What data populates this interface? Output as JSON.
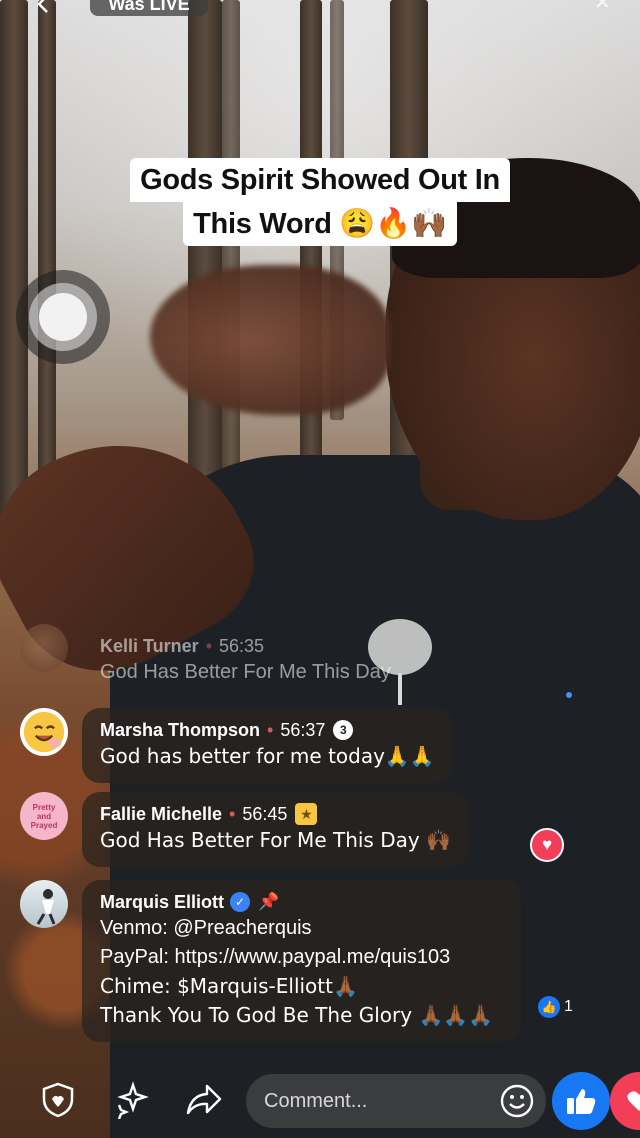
{
  "header": {
    "status_label": "Was LIVE",
    "back_icon": "back-arrow-icon",
    "close_icon": "close-icon"
  },
  "title": {
    "line1": "Gods Spirit Showed Out In",
    "line2": "This Word 😩🔥🙌🏾"
  },
  "comments": [
    {
      "name": "Kelli Turner",
      "time": "56:35",
      "text": "God Has Better For Me This Day",
      "badge": ""
    },
    {
      "name": "Marsha Thompson",
      "time": "56:37",
      "text": "God has better for me today🙏🙏",
      "badge": "3"
    },
    {
      "name": "Fallie Michelle",
      "time": "56:45",
      "text": "God Has Better For Me This Day 🙌🏾",
      "badge": "star"
    },
    {
      "name": "Marquis Elliott",
      "verified": true,
      "pinned": true,
      "lines": [
        "Venmo: @Preacherquis",
        "PayPal:  https://www.paypal.me/quis103",
        "Chime: $Marquis-Elliott🙏🏾",
        "Thank You To God Be The Glory 🙏🏾🙏🏾🙏🏾"
      ],
      "like_count": "1"
    }
  ],
  "avatars": {
    "fallie_text": "Pretty and Prayed"
  },
  "bottom_bar": {
    "comment_placeholder": "Comment...",
    "icons": [
      "shield-icon",
      "sparkle-icon",
      "share-icon",
      "smiley-icon",
      "like-icon",
      "love-icon"
    ]
  },
  "colors": {
    "like_blue": "#1877f2",
    "love_red": "#f33e58",
    "time_dot": "#ff6b6b"
  }
}
